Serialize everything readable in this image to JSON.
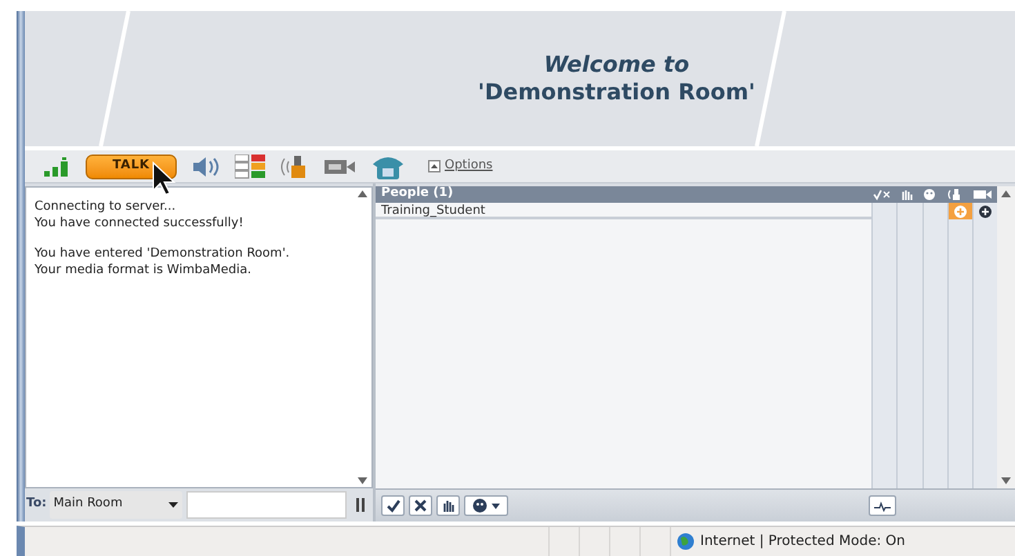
{
  "banner": {
    "title": "Welcome to",
    "room": "'Demonstration Room'"
  },
  "toolbar": {
    "talk_button": "TALK",
    "options_link": "Options"
  },
  "chat": {
    "message_groups": [
      [
        "Connecting to server...",
        "You have connected successfully!"
      ],
      [
        "You have entered 'Demonstration Room'.",
        "Your media format is WimbaMedia."
      ]
    ],
    "to_label": "To:",
    "recipient": "Main Room"
  },
  "people": {
    "header": "People (1)",
    "participants": [
      {
        "name": "Training_Student"
      }
    ]
  },
  "status_bar": {
    "zone": "Internet | Protected Mode: On"
  }
}
